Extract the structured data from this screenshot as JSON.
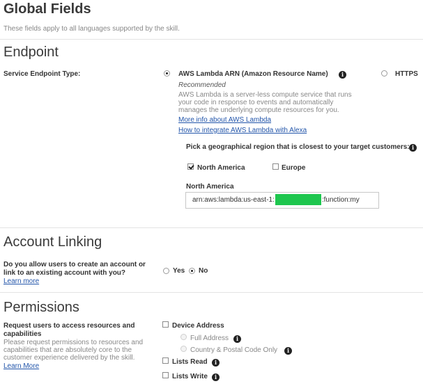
{
  "global": {
    "title": "Global Fields",
    "subtitle": "These fields apply to all languages supported by the skill."
  },
  "endpoint": {
    "heading": "Endpoint",
    "type_label": "Service Endpoint Type:",
    "option_lambda": "AWS Lambda ARN (Amazon Resource Name)",
    "recommended": "Recommended",
    "lambda_desc_1": "AWS Lambda is a server-less compute service that runs",
    "lambda_desc_2": "your code in response to events and automatically",
    "lambda_desc_3": "manages the underlying compute resources for you.",
    "link_more_info": "More info about AWS Lambda",
    "link_integrate": "How to integrate AWS Lambda with Alexa",
    "option_https": "HTTPS",
    "region_prompt": "Pick a geographical region that is closest to your target customers:",
    "region_na": "North America",
    "region_eu": "Europe",
    "region_na_label": "North America",
    "arn_prefix": "arn:aws:lambda:us-east-1:",
    "arn_suffix": ":function:my"
  },
  "account_linking": {
    "heading": "Account Linking",
    "question_1": "Do you allow users to create an account or",
    "question_2": "link to an existing account with you?",
    "learn_more": "Learn more",
    "yes": "Yes",
    "no": "No"
  },
  "permissions": {
    "heading": "Permissions",
    "label_1": "Request users to access resources and",
    "label_2": "capabilities",
    "desc_1": "Please request permissions to resources and",
    "desc_2": "capabilities that are absolutely core to the",
    "desc_3": "customer experience delivered by the skill.",
    "learn_more": "Learn More",
    "device_address": "Device Address",
    "full_address": "Full Address",
    "country_postal": "Country & Postal Code Only",
    "lists_read": "Lists Read",
    "lists_write": "Lists Write"
  },
  "colors": {
    "link": "#2255aa",
    "redaction": "#1ec64e",
    "divider": "#e3e3e3"
  }
}
